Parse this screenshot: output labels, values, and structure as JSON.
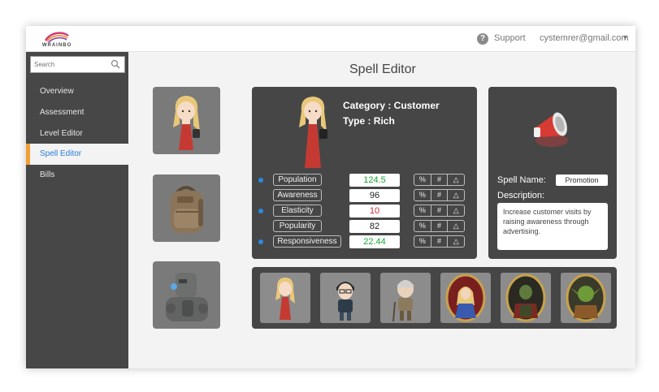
{
  "header": {
    "logo_text": "WRAINBO",
    "help_glyph": "?",
    "support_label": "Support",
    "user_email": "cystemrer@gmail.com",
    "menu_glyph": "▼"
  },
  "sidebar": {
    "search_placeholder": "Search",
    "items": [
      {
        "label": "Overview"
      },
      {
        "label": "Assessment"
      },
      {
        "label": "Level Editor"
      },
      {
        "label": "Spell Editor"
      },
      {
        "label": "Bills"
      }
    ],
    "active_index": 3
  },
  "page": {
    "title": "Spell Editor"
  },
  "thumbnails": [
    {
      "icon": "girl-character-icon"
    },
    {
      "icon": "backpack-icon"
    },
    {
      "icon": "robot-icon"
    }
  ],
  "customer": {
    "category": "Category : Customer",
    "type": "Type : Rich",
    "stats": [
      {
        "label": "Population",
        "value": "124.5",
        "color": "#1aa532"
      },
      {
        "label": "Awareness",
        "value": "96",
        "color": "#222222"
      },
      {
        "label": "Elasticity",
        "value": "10",
        "color": "#d42a2a"
      },
      {
        "label": "Popularity",
        "value": "82",
        "color": "#222222"
      },
      {
        "label": "Responsiveness",
        "value": "22.44",
        "color": "#1aa532"
      }
    ],
    "buttons": [
      "%",
      "#",
      "△"
    ]
  },
  "spell": {
    "icon": "megaphone-icon",
    "name_label": "Spell Name:",
    "name_value": "Promotion",
    "description_label": "Description:",
    "description": "Increase customer visits by raising awareness through advertising."
  },
  "characters": [
    {
      "icon": "girl-character-icon"
    },
    {
      "icon": "glasses-boy-icon"
    },
    {
      "icon": "old-man-icon"
    },
    {
      "icon": "portrait-girl-icon"
    },
    {
      "icon": "portrait-soldier-icon"
    },
    {
      "icon": "portrait-goblin-icon"
    }
  ],
  "colors": {
    "sidebar": "#474747",
    "panel": "#464646",
    "accent_blue": "#2a7fd4",
    "active_marker": "#f0a037",
    "green": "#1aa532",
    "red": "#d42a2a"
  }
}
